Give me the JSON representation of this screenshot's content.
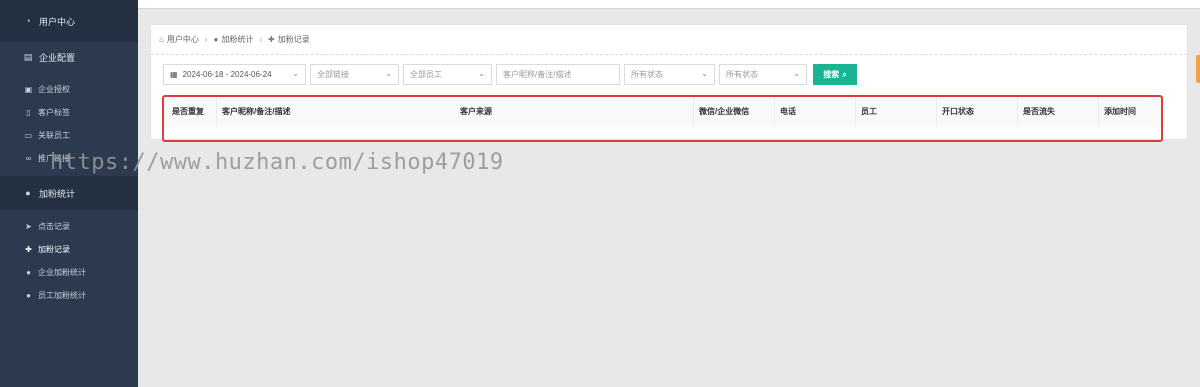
{
  "sidebar": {
    "groups": [
      {
        "label": "用户中心",
        "icon": "gauge-icon"
      },
      {
        "label": "企业配置",
        "icon": "document-icon"
      },
      {
        "label": "加粉统计",
        "icon": "user-icon"
      }
    ],
    "config_items": [
      {
        "label": "企业授权",
        "icon": "image-icon"
      },
      {
        "label": "客户标签",
        "icon": "bookmark-icon"
      },
      {
        "label": "关联员工",
        "icon": "id-card-icon"
      },
      {
        "label": "推广链接",
        "icon": "link-icon"
      }
    ],
    "stats_items": [
      {
        "label": "点击记录",
        "icon": "pointer-icon"
      },
      {
        "label": "加粉记录",
        "icon": "user-plus-icon"
      },
      {
        "label": "企业加粉统计",
        "icon": "user-icon"
      },
      {
        "label": "员工加粉统计",
        "icon": "user-icon"
      }
    ]
  },
  "breadcrumb": [
    "用户中心",
    "加粉统计",
    "加粉记录"
  ],
  "filters": {
    "date_range": "2024-06-18 - 2024-06-24",
    "link_select": "全部链接",
    "staff_select": "全部员工",
    "search_placeholder": "客户昵称/备注/描述",
    "status_select_1": "所有状态",
    "status_select_2": "所有状态",
    "search_button": "搜索"
  },
  "table": {
    "columns": [
      "是否重复",
      "客户昵称/备注/描述",
      "客户来源",
      "微信/企业微信",
      "电话",
      "员工",
      "开口状态",
      "是否流失",
      "添加时间"
    ]
  },
  "watermark": "https://www.huzhan.com/ishop47019",
  "colors": {
    "sidebar": "#2b3a4e",
    "accent": "#1ab394",
    "highlight": "#e23b3b"
  }
}
